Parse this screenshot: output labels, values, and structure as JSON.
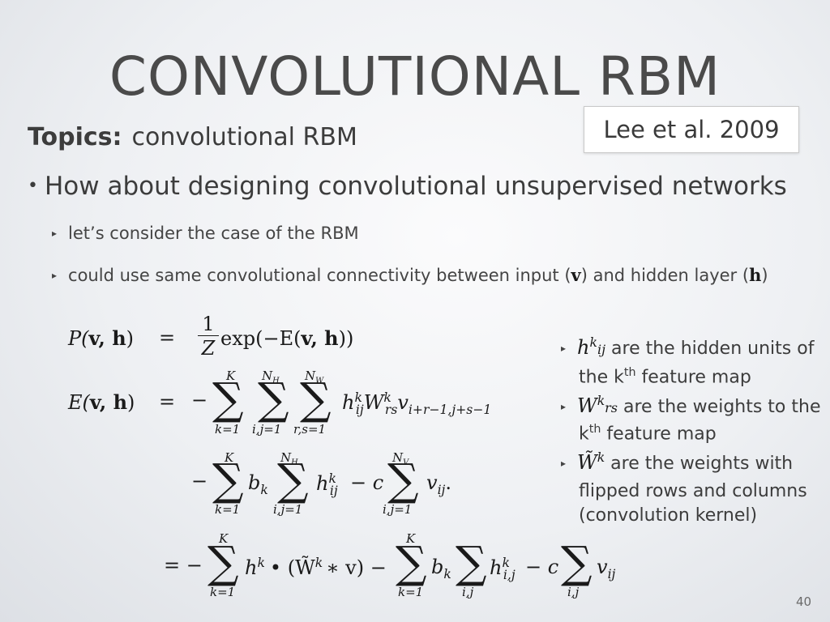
{
  "slide": {
    "title": "CONVOLUTIONAL RBM",
    "reference": "Lee et al. 2009",
    "topics_label": "Topics:",
    "topics_text": "convolutional RBM",
    "bullet_main": "How about designing convolutional unsupervised networks",
    "sub1": "let’s consider the case of the RBM",
    "sub2_a": "could use same convolutional connectivity between input (",
    "sub2_v": "v",
    "sub2_b": ") and hidden layer (",
    "sub2_h": "h",
    "sub2_c": ")",
    "page_number": "40"
  },
  "equations": {
    "p_lhs": "P(",
    "p_vh": "v, h",
    "p_close": ")",
    "eq": "=",
    "frac_num": "1",
    "frac_den": "Z",
    "p_rhs_a": "exp(−E(",
    "p_rhs_b": "))",
    "e_lhs": "E(",
    "e_close": ")",
    "minus": "−",
    "sum_K": "K",
    "sum_k1": "k=1",
    "sum_NH": "N",
    "sum_NH_sub": "H",
    "sum_ij1": "i,j=1",
    "sum_NW": "N",
    "sum_NW_sub": "W",
    "sum_rs1": "r,s=1",
    "sum_NV": "N",
    "sum_NV_sub": "V",
    "sum_ij": "i,j",
    "e_term1": "h",
    "term1_sup": "k",
    "term1_sub": "ij",
    "term1_W": "W",
    "term1_Wsup": "k",
    "term1_Wsub": "rs",
    "term1_v": "v",
    "term1_vsub": "i+r−1,j+s−1",
    "line2_b": "b",
    "line2_bsub": "k",
    "line2_h": "h",
    "line2_hsup": "k",
    "line2_hsub": "ij",
    "line2_c": "− c",
    "line2_v": "v",
    "line2_vsub": "ij",
    "line2_dot": ".",
    "line3_eq": "= −",
    "line3_h": "h",
    "line3_hsup": "k",
    "line3_mid": "• (W̃",
    "line3_Wsup": "k",
    "line3_conv": "∗ v) −",
    "line3_b": "b",
    "line3_bsub": "k",
    "line3_h2": "h",
    "line3_h2sup": "k",
    "line3_h2sub": "i,j",
    "line3_c": "− c",
    "line3_v": "v",
    "line3_vsub": "ij",
    "sigma": "∑"
  },
  "notes": {
    "n1_sym": "h",
    "n1_sup": "k",
    "n1_sub": "ij",
    "n1_text": " are the hidden units of",
    "n1_line2_a": "the k",
    "n1_line2_sup": "th",
    "n1_line2_b": " feature map",
    "n2_sym": "W",
    "n2_sup": "k",
    "n2_sub": "rs",
    "n2_text": " are the weights to the",
    "n2_line2_a": "k",
    "n2_line2_sup": "th",
    "n2_line2_b": " feature map",
    "n3_sym": "W̃",
    "n3_sup": "k",
    "n3_text": " are the weights with",
    "n3_line2": "flipped rows and columns",
    "n3_line3": "(convolution kernel)",
    "bullet_glyph": "▸"
  }
}
